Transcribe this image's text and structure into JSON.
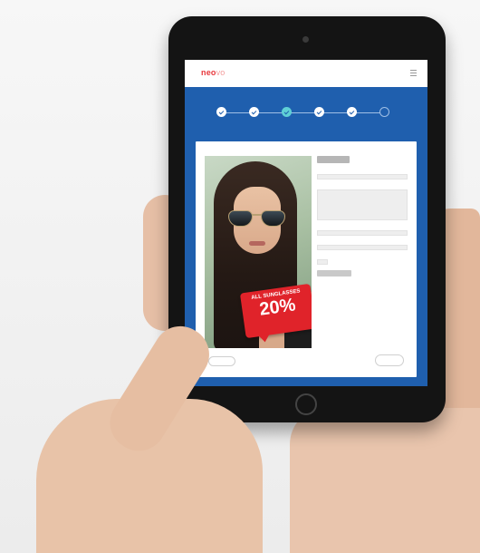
{
  "header": {
    "logo_primary": "neo",
    "logo_secondary": "vo"
  },
  "breadcrumb": "",
  "steps": [
    {
      "label": "",
      "state": "done"
    },
    {
      "label": "",
      "state": "done"
    },
    {
      "label": "",
      "state": "active"
    },
    {
      "label": "",
      "state": "done"
    },
    {
      "label": "",
      "state": "done"
    },
    {
      "label": "",
      "state": "todo"
    }
  ],
  "panel": {
    "title": ""
  },
  "promo": {
    "subtitle": "",
    "headline": "ALL SUNGLASSES",
    "percent": "20%"
  },
  "form": {
    "upload_button": "",
    "fields": [
      {
        "label": "",
        "type": "text"
      },
      {
        "label": "",
        "type": "textarea"
      },
      {
        "label": "",
        "type": "text"
      },
      {
        "label": "",
        "type": "text"
      },
      {
        "label": "",
        "type": "small"
      }
    ],
    "secondary_button": ""
  },
  "nav": {
    "back_label": "",
    "next_label": ""
  },
  "colors": {
    "brand_blue": "#1f5fae",
    "accent_red": "#e0232a",
    "active_step": "#5fd0d6"
  }
}
